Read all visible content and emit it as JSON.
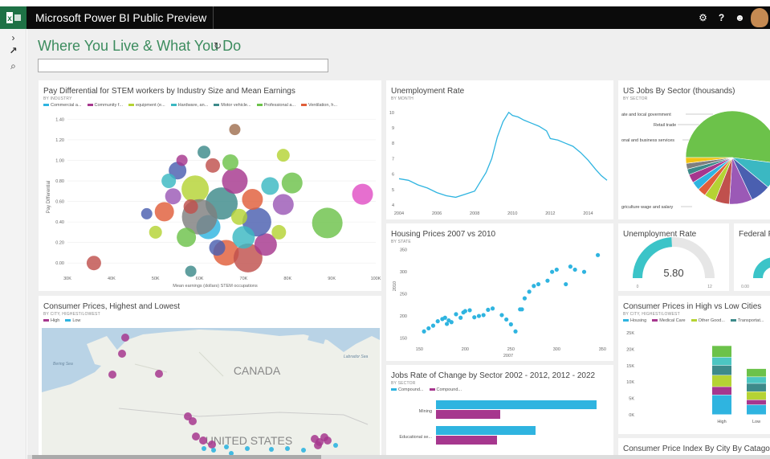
{
  "app": {
    "name": "Microsoft Power BI Public Preview"
  },
  "topbar_icons": [
    "gear-icon",
    "help-icon",
    "smiley-icon",
    "avatar"
  ],
  "topbar_glyphs": {
    "gear": "⚙",
    "help": "?",
    "smiley": "☻"
  },
  "rail": {
    "expand": "›",
    "arrow": "↗",
    "search": "⌕"
  },
  "page": {
    "title": "Where You Live & What You Do",
    "refresh_glyph": "↻"
  },
  "qa": {
    "placeholder": ""
  },
  "tiles": {
    "stem": {
      "title": "Pay Differential for STEM workers by Industry Size and Mean Earnings",
      "subtitle": "BY INDUSTRY",
      "legend": [
        {
          "label": "Commercial a...",
          "color": "#2fb4e0"
        },
        {
          "label": "Community f...",
          "color": "#a6378e"
        },
        {
          "label": "equipment (e...",
          "color": "#b5d334"
        },
        {
          "label": "Hardware, an...",
          "color": "#3bb8c2"
        },
        {
          "label": "Motor vehicle...",
          "color": "#3d8a8a"
        },
        {
          "label": "Professional a...",
          "color": "#6cc24a"
        },
        {
          "label": "Ventilation, h...",
          "color": "#e05e3a"
        }
      ],
      "ylabel": "Pay Differential",
      "xlabel": "Mean earnings (dollars) STEM occupations"
    },
    "unemp_line": {
      "title": "Unemployment Rate",
      "subtitle": "BY MONTH"
    },
    "jobs_sector": {
      "title": "US Jobs By Sector (thousands)",
      "subtitle": "BY SECTOR",
      "labels": [
        "ate and local government",
        "Retail trade",
        "onal and business services",
        "griculture wage and salary"
      ]
    },
    "housing": {
      "title": "Housing Prices 2007 vs 2010",
      "subtitle": "BY STATE",
      "ylabel": "2010",
      "xlabel": "2007"
    },
    "gauge": {
      "title": "Unemployment Rate",
      "value": "5.80",
      "min": "0",
      "max": "12"
    },
    "federal": {
      "title": "Federal Fu",
      "min": "0.00"
    },
    "consumer_map": {
      "title": "Consumer Prices, Highest and Lowest",
      "subtitle": "BY CITY, HIGHEST/LOWEST",
      "legend": [
        {
          "label": "High",
          "color": "#a6378e"
        },
        {
          "label": "Low",
          "color": "#2fb4e0"
        }
      ],
      "map_labels": {
        "canada": "CANADA",
        "us": "UNITED STATES",
        "bering": "Bering Sea",
        "labrador": "Labrador Sea"
      }
    },
    "jobs_rate": {
      "title": "Jobs Rate of Change by Sector 2002 - 2012, 2012 - 2022",
      "subtitle": "BY SECTOR",
      "legend": [
        {
          "label": "Compound...",
          "color": "#2fb4e0"
        },
        {
          "label": "Compound...",
          "color": "#a6378e"
        }
      ],
      "categories": [
        "Mining",
        "Educational se..."
      ]
    },
    "high_low": {
      "title": "Consumer Prices in High vs Low Cities",
      "subtitle": "BY CITY, HIGHEST/LOWEST",
      "legend": [
        {
          "label": "Housing",
          "color": "#2fb4e0"
        },
        {
          "label": "Medical Care",
          "color": "#a6378e"
        },
        {
          "label": "Other Good...",
          "color": "#b5d334"
        },
        {
          "label": "Transportat...",
          "color": "#3d8a8a"
        }
      ],
      "categories": [
        "High",
        "Low"
      ]
    },
    "cpi": {
      "title": "Consumer Price Index By City By Catagory"
    }
  },
  "chart_data": [
    {
      "type": "scatter",
      "title": "Pay Differential for STEM workers by Industry Size and Mean Earnings",
      "xlabel": "Mean earnings (dollars) STEM occupations",
      "ylabel": "Pay Differential",
      "x_ticks": [
        "30K",
        "40K",
        "50K",
        "60K",
        "70K",
        "80K",
        "90K",
        "100K"
      ],
      "y_ticks": [
        "0.00",
        "0.20",
        "0.40",
        "0.60",
        "0.80",
        "1.00",
        "1.20",
        "1.40"
      ],
      "xlim": [
        30000,
        100000
      ],
      "ylim": [
        -0.1,
        1.45
      ],
      "points": [
        {
          "x": 36000,
          "y": 0.0,
          "r": 9,
          "color": "#c0504d"
        },
        {
          "x": 48000,
          "y": 0.48,
          "r": 7,
          "color": "#4a5fb0"
        },
        {
          "x": 68000,
          "y": 1.3,
          "r": 7,
          "color": "#a07050"
        },
        {
          "x": 79000,
          "y": 1.05,
          "r": 8,
          "color": "#b5d334"
        },
        {
          "x": 81000,
          "y": 0.78,
          "r": 13,
          "color": "#6cc24a"
        },
        {
          "x": 97000,
          "y": 0.67,
          "r": 13,
          "color": "#e04fc4"
        },
        {
          "x": 89000,
          "y": 0.39,
          "r": 19,
          "color": "#6cc24a"
        },
        {
          "x": 79000,
          "y": 0.57,
          "r": 13,
          "color": "#9b59b6"
        },
        {
          "x": 58000,
          "y": -0.08,
          "r": 7,
          "color": "#3d8a8a"
        },
        {
          "x": 66000,
          "y": 0.1,
          "r": 16,
          "color": "#e05e3a"
        },
        {
          "x": 71000,
          "y": 0.05,
          "r": 18,
          "color": "#c0504d"
        },
        {
          "x": 75000,
          "y": 0.18,
          "r": 14,
          "color": "#a6378e"
        },
        {
          "x": 62000,
          "y": 0.35,
          "r": 15,
          "color": "#2fb4e0"
        },
        {
          "x": 65000,
          "y": 0.58,
          "r": 20,
          "color": "#3d8a8a"
        },
        {
          "x": 59000,
          "y": 0.72,
          "r": 17,
          "color": "#b5d334"
        },
        {
          "x": 55000,
          "y": 0.9,
          "r": 11,
          "color": "#4a5fb0"
        },
        {
          "x": 52000,
          "y": 0.5,
          "r": 12,
          "color": "#e05e3a"
        },
        {
          "x": 60000,
          "y": 0.45,
          "r": 22,
          "color": "#7f7f7f"
        },
        {
          "x": 68000,
          "y": 0.8,
          "r": 16,
          "color": "#a6378e"
        },
        {
          "x": 73000,
          "y": 0.4,
          "r": 18,
          "color": "#4a5fb0"
        },
        {
          "x": 70000,
          "y": 0.25,
          "r": 14,
          "color": "#3bb8c2"
        },
        {
          "x": 57000,
          "y": 0.25,
          "r": 12,
          "color": "#6cc24a"
        },
        {
          "x": 63000,
          "y": 0.95,
          "r": 9,
          "color": "#c0504d"
        },
        {
          "x": 76000,
          "y": 0.75,
          "r": 11,
          "color": "#3bb8c2"
        },
        {
          "x": 54000,
          "y": 0.65,
          "r": 10,
          "color": "#9b59b6"
        },
        {
          "x": 50000,
          "y": 0.3,
          "r": 8,
          "color": "#b5d334"
        },
        {
          "x": 61000,
          "y": 1.08,
          "r": 8,
          "color": "#3d8a8a"
        },
        {
          "x": 67000,
          "y": 0.98,
          "r": 10,
          "color": "#6cc24a"
        },
        {
          "x": 72000,
          "y": 0.62,
          "r": 13,
          "color": "#e05e3a"
        },
        {
          "x": 56000,
          "y": 1.0,
          "r": 7,
          "color": "#a6378e"
        },
        {
          "x": 64000,
          "y": 0.15,
          "r": 10,
          "color": "#4a5fb0"
        },
        {
          "x": 78000,
          "y": 0.3,
          "r": 9,
          "color": "#b5d334"
        },
        {
          "x": 53000,
          "y": 0.8,
          "r": 9,
          "color": "#3bb8c2"
        },
        {
          "x": 69000,
          "y": 0.45,
          "r": 10,
          "color": "#b5d334"
        },
        {
          "x": 58000,
          "y": 0.55,
          "r": 9,
          "color": "#c0504d"
        }
      ]
    },
    {
      "type": "line",
      "title": "Unemployment Rate",
      "x_ticks": [
        "2004",
        "2006",
        "2008",
        "2010",
        "2012",
        "2014"
      ],
      "y_ticks": [
        "4",
        "5",
        "6",
        "7",
        "8",
        "9",
        "10"
      ],
      "xlim": [
        2004,
        2015
      ],
      "ylim": [
        4,
        10.3
      ],
      "x": [
        2004,
        2004.5,
        2005,
        2005.5,
        2006,
        2006.5,
        2007,
        2007.5,
        2008,
        2008.3,
        2008.6,
        2008.9,
        2009.2,
        2009.5,
        2009.8,
        2010,
        2010.3,
        2010.6,
        2011,
        2011.4,
        2011.8,
        2012,
        2012.4,
        2012.8,
        2013.2,
        2013.6,
        2014,
        2014.4,
        2014.7,
        2015
      ],
      "y": [
        5.7,
        5.6,
        5.3,
        5.1,
        4.8,
        4.6,
        4.5,
        4.7,
        4.9,
        5.5,
        6.1,
        7.0,
        8.4,
        9.4,
        10.0,
        9.8,
        9.7,
        9.5,
        9.3,
        9.1,
        8.8,
        8.3,
        8.2,
        8.0,
        7.8,
        7.4,
        6.9,
        6.3,
        5.9,
        5.6
      ],
      "color": "#2fb4e0"
    },
    {
      "type": "pie",
      "title": "US Jobs By Sector (thousands)",
      "values": [
        52,
        9,
        7,
        8,
        5,
        4,
        3,
        3,
        3,
        2,
        2,
        2
      ],
      "colors": [
        "#6cc24a",
        "#3bb8c2",
        "#4a5fb0",
        "#9b59b6",
        "#c0504d",
        "#b5d334",
        "#e05e3a",
        "#2fb4e0",
        "#a6378e",
        "#3d8a8a",
        "#7f7f7f",
        "#f2c314"
      ]
    },
    {
      "type": "scatter",
      "title": "Housing Prices 2007 vs 2010",
      "xlabel": "2007",
      "ylabel": "2010",
      "x_ticks": [
        "150",
        "200",
        "250",
        "300",
        "350"
      ],
      "y_ticks": [
        "150",
        "200",
        "250",
        "300",
        "350"
      ],
      "xlim": [
        140,
        355
      ],
      "ylim": [
        140,
        355
      ],
      "x": [
        155,
        160,
        165,
        170,
        175,
        178,
        182,
        180,
        185,
        190,
        195,
        198,
        200,
        205,
        210,
        215,
        220,
        225,
        230,
        240,
        245,
        250,
        255,
        260,
        262,
        265,
        270,
        275,
        280,
        290,
        295,
        300,
        310,
        315,
        320,
        330,
        345
      ],
      "y": [
        165,
        172,
        178,
        188,
        193,
        196,
        190,
        182,
        186,
        204,
        196,
        208,
        211,
        213,
        197,
        200,
        202,
        214,
        217,
        202,
        192,
        181,
        165,
        215,
        215,
        240,
        255,
        268,
        272,
        280,
        300,
        305,
        272,
        312,
        305,
        300,
        338
      ],
      "color": "#2fb4e0"
    },
    {
      "type": "bar",
      "title": "Jobs Rate of Change by Sector 2002 - 2012, 2012 - 2022",
      "categories": [
        "Mining",
        "Educational se..."
      ],
      "series": [
        {
          "name": "Compound...",
          "values": [
            100,
            62
          ],
          "color": "#2fb4e0"
        },
        {
          "name": "Compound...",
          "values": [
            40,
            38
          ],
          "color": "#a6378e"
        }
      ]
    },
    {
      "type": "bar",
      "title": "Consumer Prices in High vs Low Cities",
      "categories": [
        "High",
        "Low"
      ],
      "y_ticks": [
        "0K",
        "5K",
        "10K",
        "15K",
        "20K",
        "25K"
      ],
      "ylim": [
        0,
        25000
      ],
      "stacks": [
        {
          "color": "#2fb4e0",
          "values": [
            6000,
            3000
          ]
        },
        {
          "color": "#a6378e",
          "values": [
            2500,
            1500
          ]
        },
        {
          "color": "#b5d334",
          "values": [
            3500,
            2500
          ]
        },
        {
          "color": "#3d8a8a",
          "values": [
            3000,
            2500
          ]
        },
        {
          "color": "#4cc6c2",
          "values": [
            2500,
            2000
          ]
        },
        {
          "color": "#6cc24a",
          "values": [
            3500,
            2500
          ]
        }
      ]
    }
  ]
}
